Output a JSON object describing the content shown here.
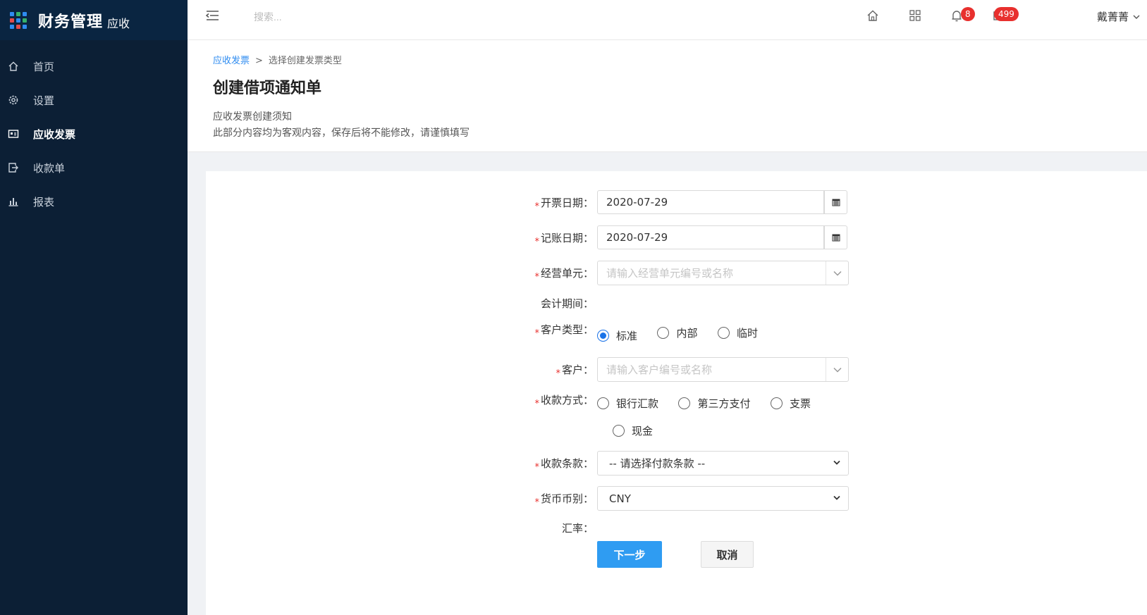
{
  "app": {
    "title": "财务管理",
    "subtitle": "应收"
  },
  "sidebar": {
    "items": [
      {
        "label": "首页",
        "icon": "home-icon"
      },
      {
        "label": "设置",
        "icon": "gear-icon"
      },
      {
        "label": "应收发票",
        "icon": "invoice-icon",
        "active": true
      },
      {
        "label": "收款单",
        "icon": "receipt-icon"
      },
      {
        "label": "报表",
        "icon": "bar-chart-icon"
      }
    ]
  },
  "header": {
    "search_placeholder": "搜索...",
    "notifications_count": "8",
    "messages_count": "499",
    "user_name": "戴菁菁"
  },
  "breadcrumb": {
    "root": "应收发票",
    "sep": ">",
    "current": "选择创建发票类型"
  },
  "page": {
    "title": "创建借项通知单",
    "notice_title": "应收发票创建须知",
    "notice_text": "此部分内容均为客观内容，保存后将不能修改，请谨慎填写"
  },
  "form": {
    "invoice_date_label": "开票日期：",
    "invoice_date_value": "2020-07-29",
    "posting_date_label": "记账日期：",
    "posting_date_value": "2020-07-29",
    "business_unit_label": "经营单元：",
    "business_unit_placeholder": "请输入经营单元编号或名称",
    "period_label": "会计期间：",
    "customer_type_label": "客户类型：",
    "customer_types": [
      "标准",
      "内部",
      "临时"
    ],
    "customer_type_selected": 0,
    "customer_label": "客户：",
    "customer_placeholder": "请输入客户编号或名称",
    "payment_method_label": "收款方式：",
    "payment_methods": [
      "银行汇款",
      "第三方支付",
      "支票",
      "现金"
    ],
    "payment_terms_label": "收款条款：",
    "payment_terms_value": "-- 请选择付款条款 --",
    "currency_label": "货币币别：",
    "currency_value": "CNY",
    "rate_label": "汇率：",
    "required_mark": "*",
    "next_button": "下一步",
    "cancel_button": "取消"
  },
  "colors": {
    "sidebar_bg": "#0c1f35",
    "primary": "#2f9cf2",
    "link": "#2f8cf0",
    "badge": "#e8302e"
  }
}
